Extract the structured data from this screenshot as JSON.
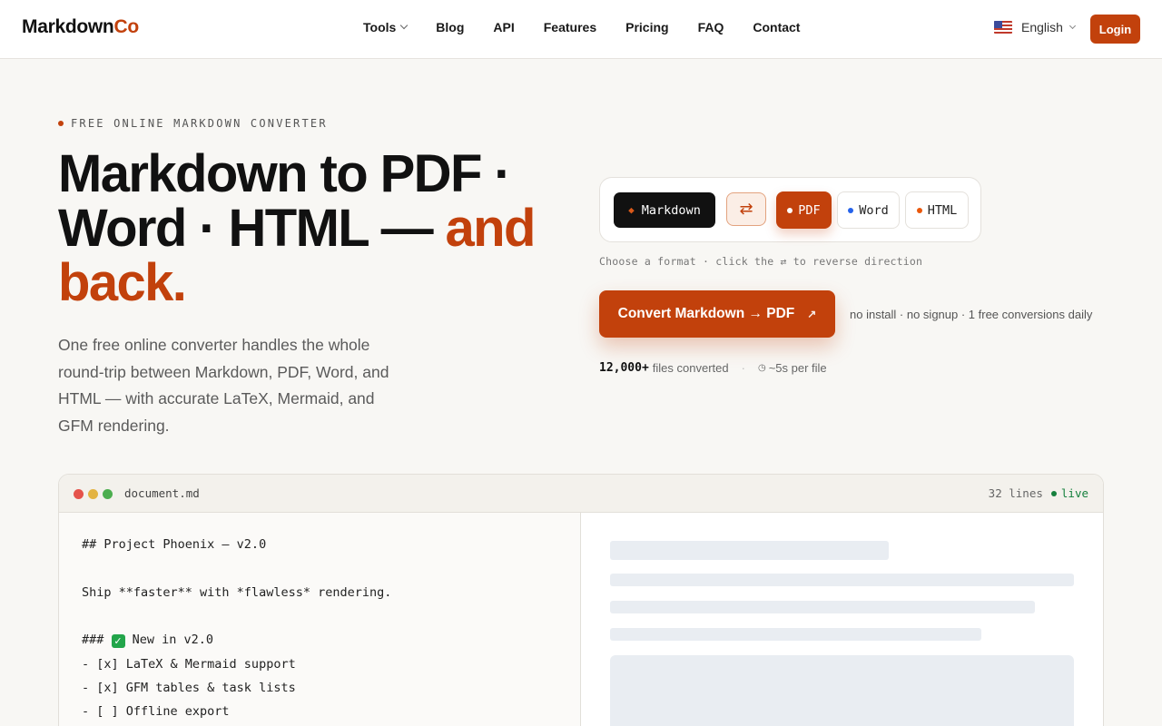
{
  "nav": {
    "logo_main": "Markdown",
    "logo_accent": "Co",
    "items": [
      {
        "label": "Tools",
        "has_dropdown": true
      },
      {
        "label": "Blog"
      },
      {
        "label": "API"
      },
      {
        "label": "Features"
      },
      {
        "label": "Pricing"
      },
      {
        "label": "FAQ"
      },
      {
        "label": "Contact"
      }
    ],
    "language": "English",
    "login_label": "Login"
  },
  "hero": {
    "eyebrow": "FREE ONLINE MARKDOWN CONVERTER",
    "headline_line1": "Markdown to PDF ·",
    "headline_line2": "Word · HTML — ",
    "headline_accent_a": "and",
    "headline_accent_b": "back.",
    "lead": "One free online converter handles the whole round-trip between Markdown, PDF, Word, and HTML — with accurate LaTeX, Mermaid, and GFM rendering."
  },
  "converter": {
    "source_format": "Markdown",
    "swap_symbol": "⇄",
    "targets": [
      {
        "label": "PDF",
        "dot_color": "#ffffff",
        "active": true
      },
      {
        "label": "Word",
        "dot_color": "#2563eb",
        "active": false
      },
      {
        "label": "HTML",
        "dot_color": "#ea580c",
        "active": false
      }
    ],
    "hint": "Choose a format · click the ⇄ to reverse direction",
    "cta_label": "Convert Markdown → PDF",
    "cta_arrow": "↗",
    "cta_note": "no install · no signup · 1 free conversions daily",
    "stats_count": "12,000+",
    "stats_count_label": "files converted",
    "stats_sep": "·",
    "stats_time": "~5s per file"
  },
  "editor": {
    "filename": "document.md",
    "line_count": "32 lines",
    "status": "live",
    "code_lines": [
      "## Project Phoenix — v2.0",
      "Ship **faster** with *flawless* rendering.",
      "### ",
      " New in v2.0",
      "- [x] LaTeX & Mermaid support",
      "- [x] GFM tables & task lists",
      "- [ ] Offline export"
    ]
  },
  "colors": {
    "accent": "#c2410c",
    "dark": "#111111",
    "live": "#15803d"
  }
}
